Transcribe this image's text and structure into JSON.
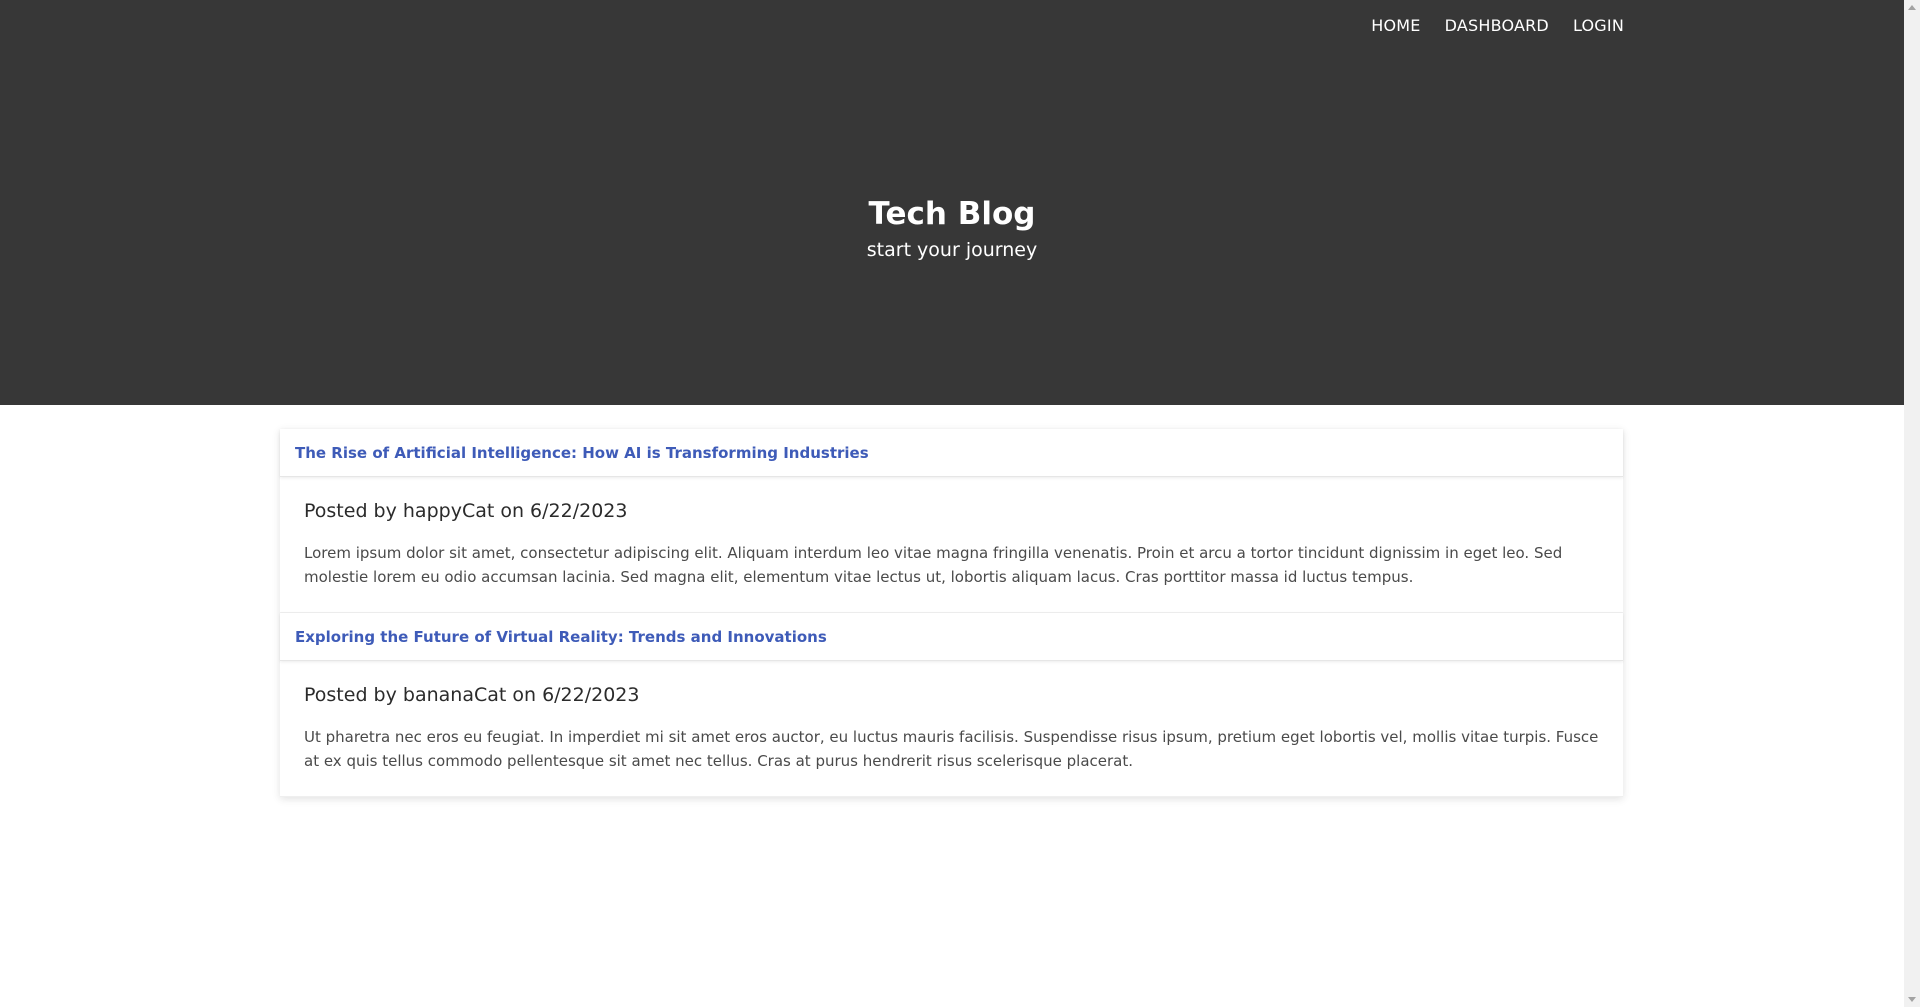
{
  "nav": {
    "items": [
      {
        "label": "HOME"
      },
      {
        "label": "DASHBOARD"
      },
      {
        "label": "LOGIN"
      }
    ]
  },
  "hero": {
    "title": "Tech Blog",
    "subtitle": "start your journey"
  },
  "posts": [
    {
      "title": "The Rise of Artificial Intelligence: How AI is Transforming Industries",
      "meta": "Posted by happyCat on 6/22/2023",
      "content": "Lorem ipsum dolor sit amet, consectetur adipiscing elit. Aliquam interdum leo vitae magna fringilla venenatis. Proin et arcu a tortor tincidunt dignissim in eget leo. Sed molestie lorem eu odio accumsan lacinia. Sed magna elit, elementum vitae lectus ut, lobortis aliquam lacus. Cras porttitor massa id luctus tempus."
    },
    {
      "title": "Exploring the Future of Virtual Reality: Trends and Innovations",
      "meta": "Posted by bananaCat on 6/22/2023",
      "content": "Ut pharetra nec eros eu feugiat. In imperdiet mi sit amet eros auctor, eu luctus mauris facilisis. Suspendisse risus ipsum, pretium eget lobortis vel, mollis vitae turpis. Fusce at ex quis tellus commodo pellentesque sit amet nec tellus. Cras at purus hendrerit risus scelerisque placerat."
    }
  ],
  "colors": {
    "hero_bg": "#373737",
    "post_title": "#3e5bb8"
  }
}
